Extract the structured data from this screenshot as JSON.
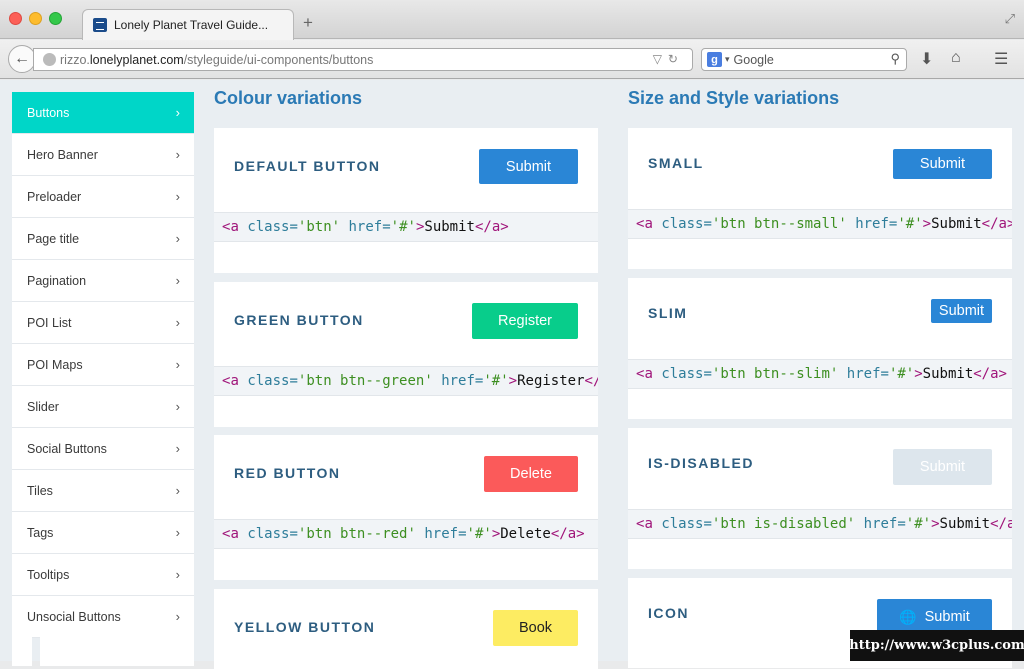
{
  "browser": {
    "tab_title": "Lonely Planet Travel Guide...",
    "new_tab": "+",
    "url_prefix": "rizzo.",
    "url_host": "lonelyplanet.com",
    "url_path": "/styleguide/ui-components/buttons",
    "search_placeholder": "Google",
    "search_engine_icon": "g-icon"
  },
  "sidebar": {
    "items": [
      {
        "label": "Buttons",
        "active": true
      },
      {
        "label": "Hero Banner"
      },
      {
        "label": "Preloader"
      },
      {
        "label": "Page title"
      },
      {
        "label": "Pagination"
      },
      {
        "label": "POI List"
      },
      {
        "label": "POI Maps"
      },
      {
        "label": "Slider"
      },
      {
        "label": "Social Buttons"
      },
      {
        "label": "Tiles"
      },
      {
        "label": "Tags"
      },
      {
        "label": "Tooltips"
      },
      {
        "label": "Unsocial Buttons"
      }
    ]
  },
  "colour": {
    "title": "Colour variations",
    "cards": [
      {
        "label": "DEFAULT BUTTON",
        "button": "Submit",
        "color": "#2a86d6",
        "code": {
          "cls": "btn",
          "text": "Submit"
        }
      },
      {
        "label": "GREEN BUTTON",
        "button": "Register",
        "color": "#08cd8b",
        "code": {
          "cls": "btn btn--green",
          "text": "Register"
        }
      },
      {
        "label": "RED BUTTON",
        "button": "Delete",
        "color": "#fb5a5a",
        "code": {
          "cls": "btn btn--red",
          "text": "Delete"
        }
      },
      {
        "label": "YELLOW BUTTON",
        "button": "Book",
        "color": "#fdec62"
      }
    ]
  },
  "size": {
    "title": "Size and Style variations",
    "cards": [
      {
        "label": "SMALL",
        "button": "Submit",
        "color": "#2a86d6",
        "code": {
          "cls": "btn btn--small",
          "text": "Submit"
        }
      },
      {
        "label": "SLIM",
        "button": "Submit",
        "color": "#2a86d6",
        "code": {
          "cls": "btn btn--slim",
          "text": "Submit"
        }
      },
      {
        "label": "IS-DISABLED",
        "button": "Submit",
        "color": "#dde6ed",
        "code": {
          "cls": "btn is-disabled",
          "text": "Submit"
        }
      },
      {
        "label": "ICON",
        "button": "Submit",
        "color": "#2a86d6",
        "icon": "globe-icon"
      }
    ]
  },
  "code_tokens": {
    "open": "<",
    "tag": "a",
    "class_attr": "class",
    "href_attr": "href",
    "eq": "=",
    "href_val": "'#'",
    "close_open": "</",
    "gt": ">"
  },
  "watermark": "http://www.w3cplus.com"
}
